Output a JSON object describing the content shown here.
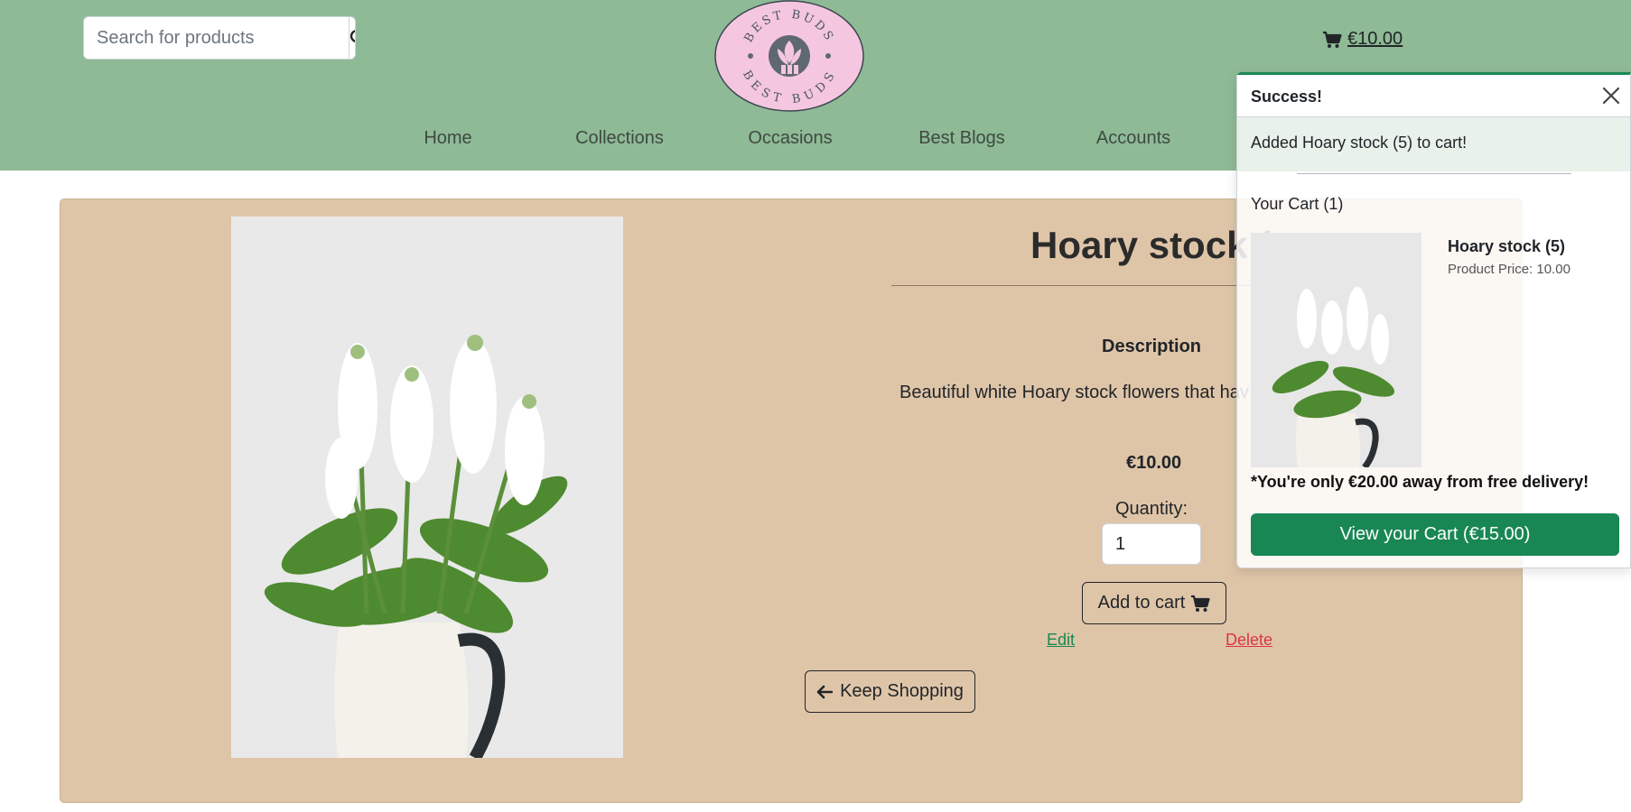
{
  "header": {
    "search": {
      "placeholder": "Search for products"
    },
    "cart_total": "€10.00",
    "logo_text_top": "BEST BUDS",
    "logo_text_bottom": "BEST BUDS",
    "nav": [
      {
        "label": "Home"
      },
      {
        "label": "Collections"
      },
      {
        "label": "Occasions"
      },
      {
        "label": "Best Blogs"
      },
      {
        "label": "Accounts"
      }
    ]
  },
  "product": {
    "title": "Hoary stock (",
    "description_heading": "Description",
    "description": "Beautiful white Hoary stock flowers that hav",
    "price": "€10.00",
    "quantity_label": "Quantity:",
    "quantity_value": "1",
    "add_to_cart_label": "Add to cart",
    "edit_label": "Edit",
    "delete_label": "Delete",
    "keep_shopping_label": "Keep Shopping"
  },
  "toast": {
    "title": "Success!",
    "message": "Added Hoary stock (5) to cart!",
    "cart_count": "Your Cart (1)",
    "item_name": "Hoary stock (5)",
    "item_price": "Product Price: 10.00",
    "delivery_note": "*You're only €20.00 away from free delivery!",
    "view_cart_label": "View your Cart (€15.00)"
  },
  "colors": {
    "header_bg": "#8fba96",
    "card_bg": "#dfc5a8",
    "logo_bg": "#f5c6df",
    "success": "#198754",
    "danger": "#dc3545"
  },
  "icons": [
    "search-icon",
    "cart-icon",
    "close-icon",
    "arrow-left-icon"
  ]
}
